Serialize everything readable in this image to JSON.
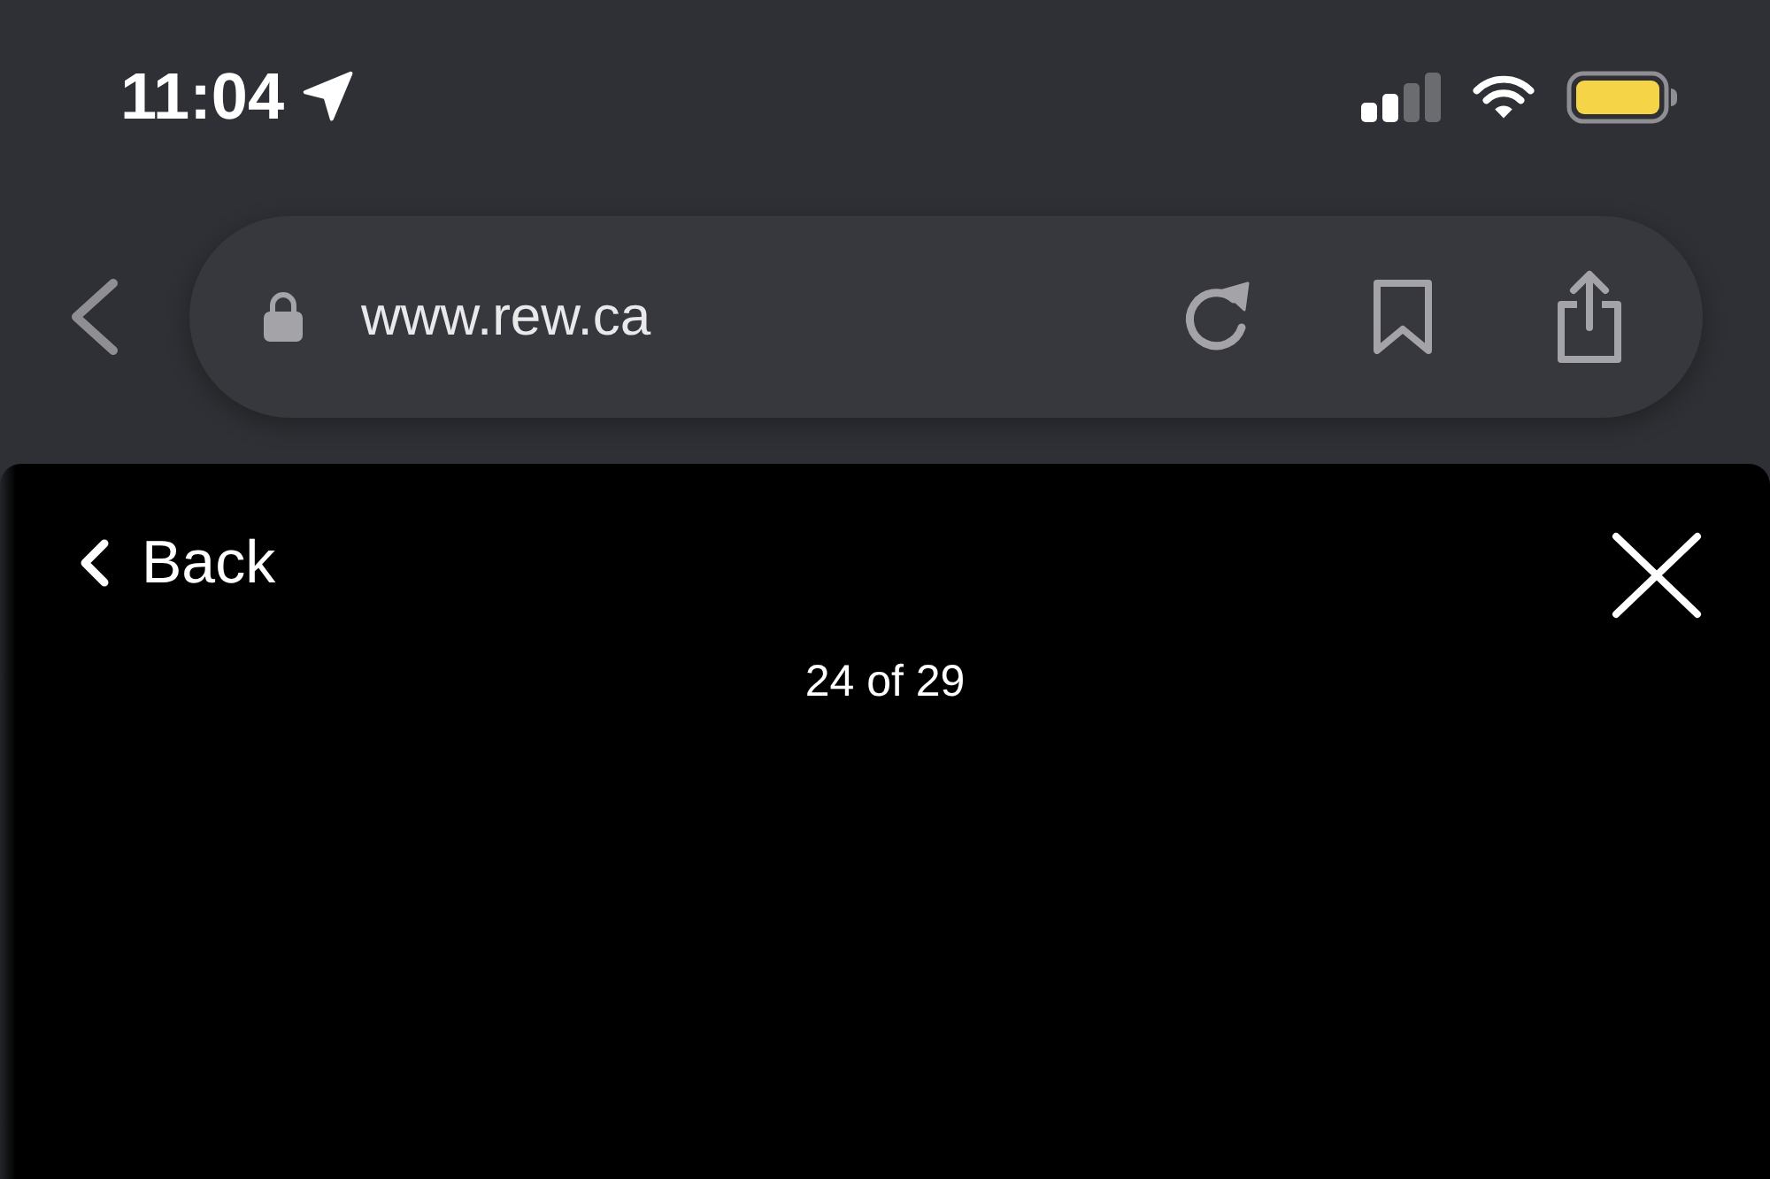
{
  "status_bar": {
    "time": "11:04"
  },
  "browser_bar": {
    "url": "www.rew.ca"
  },
  "gallery": {
    "back_label": "Back",
    "counter": "24 of 29"
  }
}
